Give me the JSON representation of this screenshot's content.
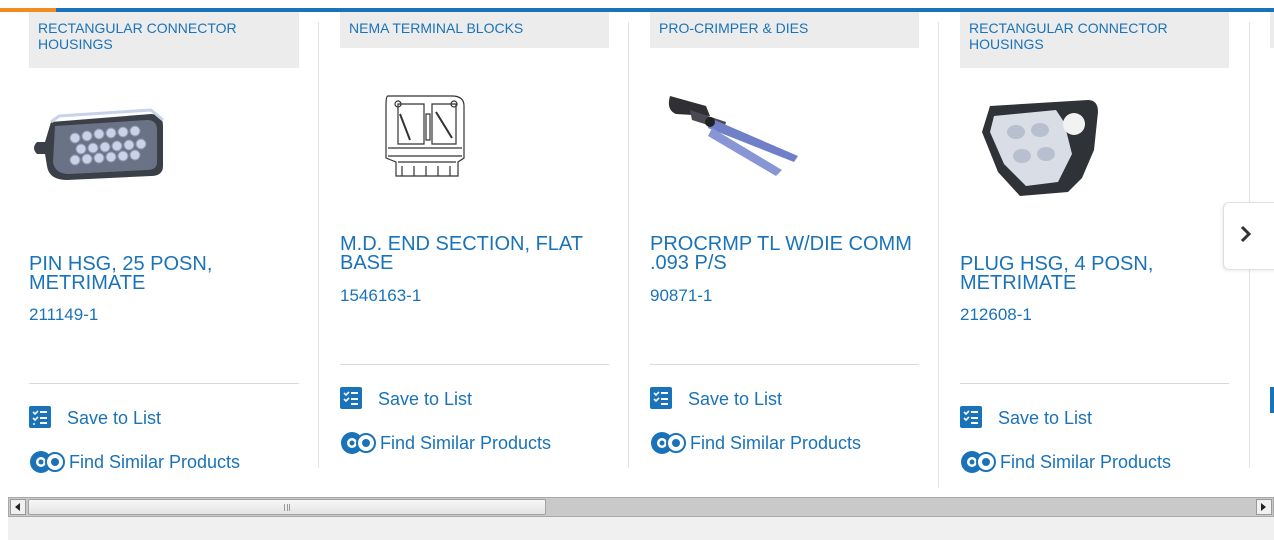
{
  "cards": [
    {
      "category": "RECTANGULAR CONNECTOR HOUSINGS",
      "name": "PIN HSG, 25 POSN, METRIMATE",
      "part_number": "211149-1",
      "save_label": "Save to List",
      "similar_label": "Find Similar Products",
      "image_icon": "pin-housing-image"
    },
    {
      "category": "NEMA TERMINAL BLOCKS",
      "name": "M.D. END SECTION, FLAT BASE",
      "part_number": "1546163-1",
      "save_label": "Save to List",
      "similar_label": "Find Similar Products",
      "image_icon": "terminal-block-image"
    },
    {
      "category": "PRO-CRIMPER & DIES",
      "name": "PROCRMP TL W/DIE COMM .093 P/S",
      "part_number": "90871-1",
      "save_label": "Save to List",
      "similar_label": "Find Similar Products",
      "image_icon": "crimper-tool-image"
    },
    {
      "category": "RECTANGULAR CONNECTOR HOUSINGS",
      "name": "PLUG HSG, 4 POSN, METRIMATE",
      "part_number": "212608-1",
      "save_label": "Save to List",
      "similar_label": "Find Similar Products",
      "image_icon": "plug-housing-image"
    }
  ],
  "carousel": {
    "next_icon": "chevron-right-icon"
  },
  "colors": {
    "link": "#1a73b8",
    "accent_orange": "#f28c1e",
    "category_bg": "#ececec"
  }
}
